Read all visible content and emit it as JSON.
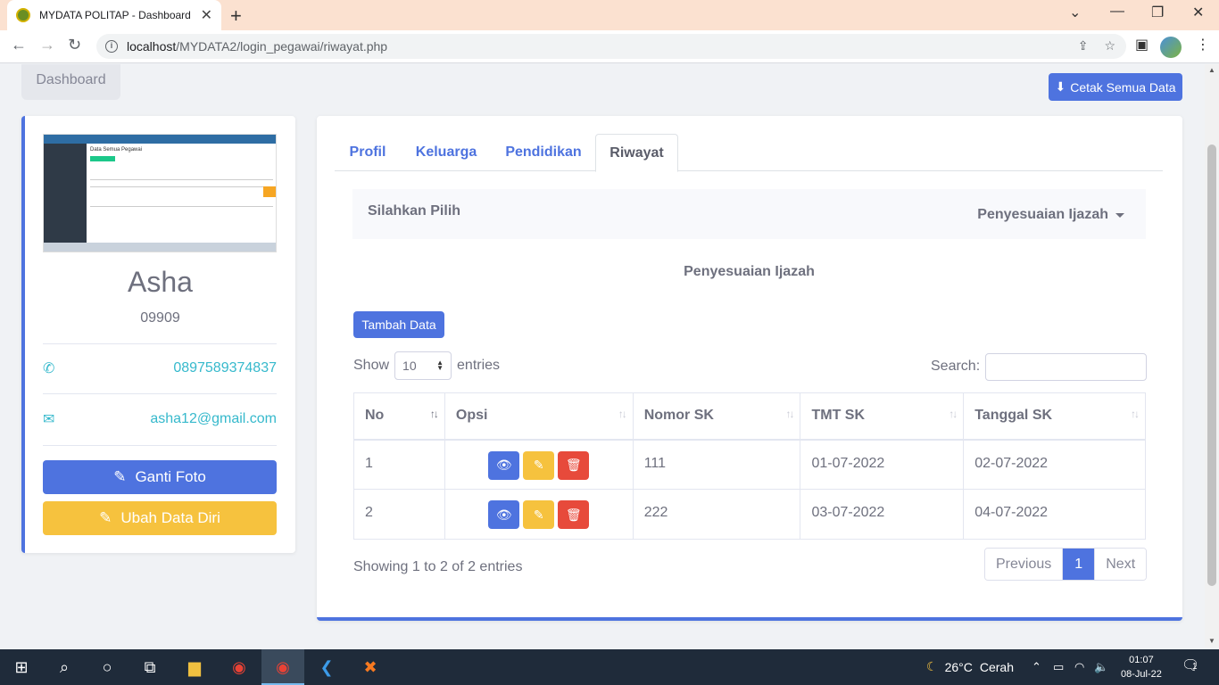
{
  "browser": {
    "tab_title": "MYDATA POLITAP - Dashboard",
    "url_host": "localhost",
    "url_path": "/MYDATA2/login_pegawai/riwayat.php"
  },
  "breadcrumb": "Dashboard",
  "print_button": "Cetak Semua Data",
  "profile": {
    "name": "Asha",
    "id": "09909",
    "phone": "0897589374837",
    "email": "asha12@gmail.com",
    "change_photo": "Ganti Foto",
    "edit_data": "Ubah Data Diri"
  },
  "tabs": [
    {
      "label": "Profil",
      "active": false
    },
    {
      "label": "Keluarga",
      "active": false
    },
    {
      "label": "Pendidikan",
      "active": false
    },
    {
      "label": "Riwayat",
      "active": true
    }
  ],
  "select_bar": {
    "label": "Silahkan Pilih",
    "dropdown": "Penyesuaian Ijazah"
  },
  "section_title": "Penyesuaian Ijazah",
  "add_button": "Tambah Data",
  "table_controls": {
    "show": "Show",
    "entries_value": "10",
    "entries": "entries",
    "search_label": "Search:"
  },
  "table": {
    "headers": [
      "No",
      "Opsi",
      "Nomor SK",
      "TMT SK",
      "Tanggal SK"
    ],
    "rows": [
      {
        "no": "1",
        "nomor_sk": "111",
        "tmt_sk": "01-07-2022",
        "tanggal_sk": "02-07-2022"
      },
      {
        "no": "2",
        "nomor_sk": "222",
        "tmt_sk": "03-07-2022",
        "tanggal_sk": "04-07-2022"
      }
    ]
  },
  "footer_info": "Showing 1 to 2 of 2 entries",
  "pagination": {
    "previous": "Previous",
    "current": "1",
    "next": "Next"
  },
  "thumbnail": {
    "title": "Data Semua Pegawai"
  },
  "taskbar": {
    "temperature": "26°C",
    "weather": "Cerah",
    "time": "01:07",
    "date": "08-Jul-22",
    "notifications": "1"
  },
  "colors": {
    "primary": "#4e73df",
    "warning": "#f6c23e",
    "danger": "#e74a3b",
    "info": "#36b9cc"
  }
}
